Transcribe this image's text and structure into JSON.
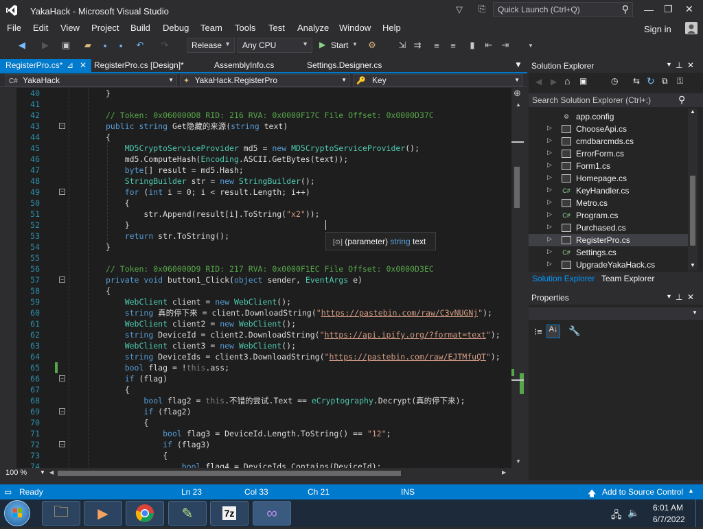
{
  "window": {
    "title": "YakaHack - Microsoft Visual Studio",
    "quick_launch_placeholder": "Quick Launch (Ctrl+Q)",
    "sign_in": "Sign in"
  },
  "menu": [
    "File",
    "Edit",
    "View",
    "Project",
    "Build",
    "Debug",
    "Team",
    "Tools",
    "Test",
    "Analyze",
    "Window",
    "Help"
  ],
  "toolbar": {
    "config": "Release",
    "platform": "Any CPU",
    "start": "Start"
  },
  "tabs": [
    {
      "label": "RegisterPro.cs*",
      "active": true
    },
    {
      "label": "RegisterPro.cs [Design]*"
    },
    {
      "label": "AssemblyInfo.cs"
    },
    {
      "label": "Settings.Designer.cs"
    }
  ],
  "nav": {
    "project": "YakaHack",
    "class": "YakaHack.RegisterPro",
    "member": "Key"
  },
  "editor": {
    "zoom": "100 %",
    "lines": [
      {
        "n": "40",
        "text": "}"
      },
      {
        "n": "41",
        "text": ""
      },
      {
        "n": "42",
        "text": "// Token: 0x060000D8 RID: 216 RVA: 0x0000F17C File Offset: 0x0000D37C"
      },
      {
        "n": "43",
        "text": "public string Get隐藏的来源(string text)"
      },
      {
        "n": "44",
        "text": "{"
      },
      {
        "n": "45",
        "text": "    MD5CryptoServiceProvider md5 = new MD5CryptoServiceProvider();"
      },
      {
        "n": "46",
        "text": "    md5.ComputeHash(Encoding.ASCII.GetBytes(text));"
      },
      {
        "n": "47",
        "text": "    byte[] result = md5.Hash;"
      },
      {
        "n": "48",
        "text": "    StringBuilder str = new StringBuilder();"
      },
      {
        "n": "49",
        "text": "    for (int i = 0; i < result.Length; i++)"
      },
      {
        "n": "50",
        "text": "    {"
      },
      {
        "n": "51",
        "text": "        str.Append(result[i].ToString(\"x2\"));"
      },
      {
        "n": "52",
        "text": "    }"
      },
      {
        "n": "53",
        "text": "    return str.ToString();"
      },
      {
        "n": "54",
        "text": "}"
      },
      {
        "n": "55",
        "text": ""
      },
      {
        "n": "56",
        "text": "// Token: 0x060000D9 RID: 217 RVA: 0x0000F1EC File Offset: 0x0000D3EC"
      },
      {
        "n": "57",
        "text": "private void button1_Click(object sender, EventArgs e)"
      },
      {
        "n": "58",
        "text": "{"
      },
      {
        "n": "59",
        "text": "    WebClient client = new WebClient();"
      },
      {
        "n": "60",
        "text": "    string 真的停下来 = client.DownloadString(\"https://pastebin.com/raw/C3vNUGNj\");"
      },
      {
        "n": "61",
        "text": "    WebClient client2 = new WebClient();"
      },
      {
        "n": "62",
        "text": "    string DeviceId = client2.DownloadString(\"https://api.ipify.org/?format=text\");"
      },
      {
        "n": "63",
        "text": "    WebClient client3 = new WebClient();"
      },
      {
        "n": "64",
        "text": "    string DeviceIds = client3.DownloadString(\"https://pastebin.com/raw/EJTMfuQT\");"
      },
      {
        "n": "65",
        "text": "    bool flag = !this.ass;"
      },
      {
        "n": "66",
        "text": "    if (flag)"
      },
      {
        "n": "67",
        "text": "    {"
      },
      {
        "n": "68",
        "text": "        bool flag2 = this.不错的尝试.Text == eCryptography.Decrypt(真的停下来);"
      },
      {
        "n": "69",
        "text": "        if (flag2)"
      },
      {
        "n": "70",
        "text": "        {"
      },
      {
        "n": "71",
        "text": "            bool flag3 = DeviceId.Length.ToString() == \"12\";"
      },
      {
        "n": "72",
        "text": "            if (flag3)"
      },
      {
        "n": "73",
        "text": "            {"
      },
      {
        "n": "74",
        "text": "                bool flag4 = DeviceIds.Contains(DeviceId);"
      }
    ],
    "tooltip": {
      "prefix": "(parameter)",
      "type": "string",
      "name": "text"
    }
  },
  "solution_explorer": {
    "title": "Solution Explorer",
    "search_placeholder": "Search Solution Explorer (Ctrl+;)",
    "items": [
      {
        "label": "app.config",
        "icon": "config"
      },
      {
        "label": "ChooseApi.cs",
        "icon": "form"
      },
      {
        "label": "cmdbarcmds.cs",
        "icon": "form"
      },
      {
        "label": "ErrorForm.cs",
        "icon": "form"
      },
      {
        "label": "Form1.cs",
        "icon": "form"
      },
      {
        "label": "Homepage.cs",
        "icon": "form"
      },
      {
        "label": "KeyHandler.cs",
        "icon": "cs"
      },
      {
        "label": "Metro.cs",
        "icon": "form"
      },
      {
        "label": "Program.cs",
        "icon": "cs"
      },
      {
        "label": "Purchased.cs",
        "icon": "form"
      },
      {
        "label": "RegisterPro.cs",
        "icon": "form",
        "selected": true
      },
      {
        "label": "Settings.cs",
        "icon": "cs"
      },
      {
        "label": "UpgradeYakaHack.cs",
        "icon": "form"
      }
    ],
    "bottom_tabs": [
      "Solution Explorer",
      "Team Explorer"
    ]
  },
  "properties": {
    "title": "Properties"
  },
  "status": {
    "ready": "Ready",
    "ln": "Ln 23",
    "col": "Col 33",
    "ch": "Ch 21",
    "ins": "INS",
    "source_control": "Add to Source Control"
  },
  "taskbar": {
    "time": "6:01 AM",
    "date": "6/7/2022",
    "apps": [
      "explorer",
      "media-player",
      "chrome",
      "notepad",
      "7zip",
      "visual-studio"
    ],
    "app_7z_label": "7z"
  },
  "colors": {
    "accent": "#007acc",
    "keyword": "#569cd6",
    "type": "#4ec9b0",
    "comment": "#57a64a",
    "string": "#d69d85"
  }
}
